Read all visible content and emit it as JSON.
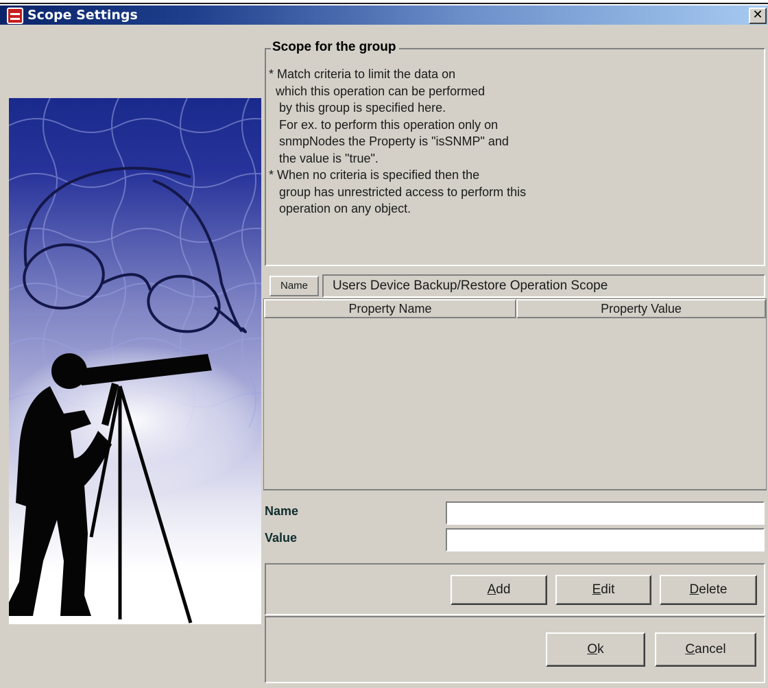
{
  "window": {
    "title": "Scope Settings",
    "close_glyph": "✕"
  },
  "scope": {
    "legend": "Scope for the group",
    "lines": [
      "* Match criteria to limit the data on",
      "  which this operation can be performed",
      "   by this group is specified here.",
      "   For ex. to perform this operation only on",
      "   snmpNodes the Property is \"isSNMP\" and",
      "   the value is \"true\".",
      "* When no criteria is specified then the",
      "   group has unrestricted access to perform this",
      "   operation on any object."
    ]
  },
  "name_row": {
    "label": "Name",
    "value": "Users Device Backup/Restore Operation Scope"
  },
  "table": {
    "columns": [
      "Property Name",
      "Property Value"
    ],
    "rows": []
  },
  "form": {
    "name_label": "Name",
    "value_label": "Value",
    "name_value": "",
    "value_value": ""
  },
  "buttons": {
    "add": {
      "mnemonic": "A",
      "rest": "dd"
    },
    "edit": {
      "mnemonic": "E",
      "rest": "dit"
    },
    "delete": {
      "mnemonic": "D",
      "rest": "elete"
    },
    "ok": {
      "mnemonic": "O",
      "rest": "k"
    },
    "cancel": {
      "mnemonic": "C",
      "rest": "ancel"
    }
  },
  "icons": {
    "app": "app-icon",
    "close": "close-icon",
    "illustration": "telescope-man-illustration"
  }
}
